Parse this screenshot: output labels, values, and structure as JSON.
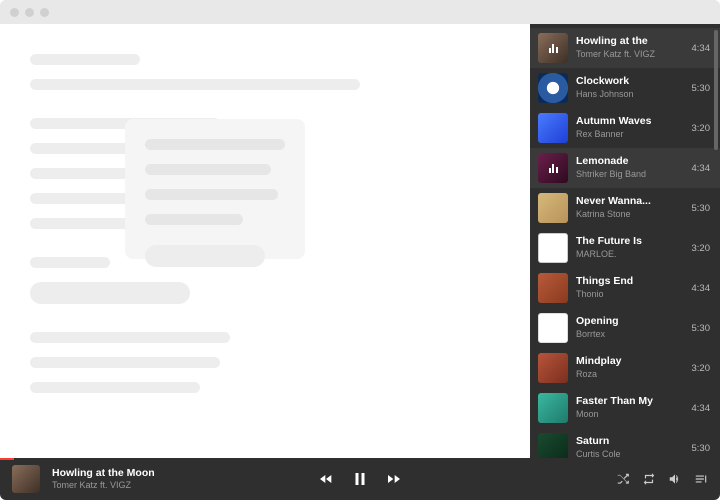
{
  "player": {
    "now_playing_title": "Howling at the Moon",
    "now_playing_artist": "Tomer Katz ft. VIGZ",
    "progress_pct": 2
  },
  "playlist": [
    {
      "title": "Howling at the",
      "artist": "Tomer Katz ft. VIGZ",
      "duration": "4:34",
      "active": true,
      "thumb": 0
    },
    {
      "title": "Clockwork",
      "artist": "Hans Johnson",
      "duration": "5:30",
      "active": false,
      "thumb": 1
    },
    {
      "title": "Autumn Waves",
      "artist": "Rex Banner",
      "duration": "3:20",
      "active": false,
      "thumb": 2
    },
    {
      "title": "Lemonade",
      "artist": "Shtriker Big Band",
      "duration": "4:34",
      "active": true,
      "thumb": 3
    },
    {
      "title": "Never Wanna...",
      "artist": "Katrina Stone",
      "duration": "5:30",
      "active": false,
      "thumb": 4
    },
    {
      "title": "The Future Is",
      "artist": "MARLOE.",
      "duration": "3:20",
      "active": false,
      "thumb": 5
    },
    {
      "title": "Things End",
      "artist": "Thonio",
      "duration": "4:34",
      "active": false,
      "thumb": 6
    },
    {
      "title": "Opening",
      "artist": "Borrtex",
      "duration": "5:30",
      "active": false,
      "thumb": 7
    },
    {
      "title": "Mindplay",
      "artist": "Roza",
      "duration": "3:20",
      "active": false,
      "thumb": 8
    },
    {
      "title": "Faster Than My",
      "artist": "Moon",
      "duration": "4:34",
      "active": false,
      "thumb": 9
    },
    {
      "title": "Saturn",
      "artist": "Curtis Cole",
      "duration": "5:30",
      "active": false,
      "thumb": 10
    }
  ]
}
